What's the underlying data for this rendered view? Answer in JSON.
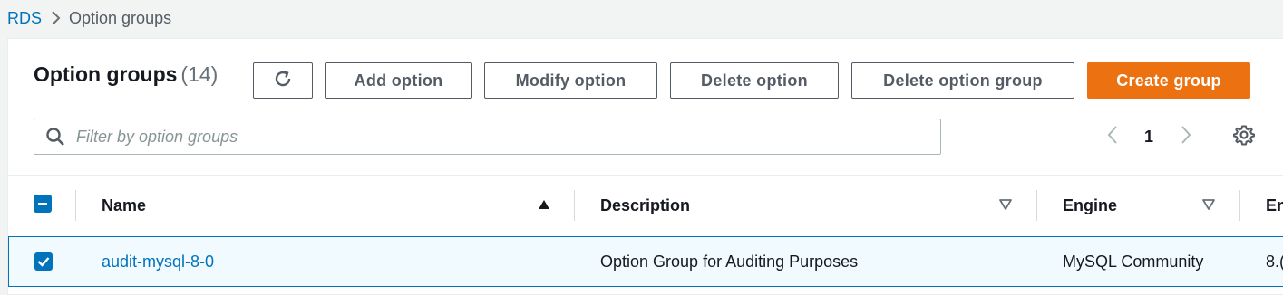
{
  "breadcrumb": {
    "root": "RDS",
    "current": "Option groups"
  },
  "header": {
    "title": "Option groups",
    "count": "(14)"
  },
  "toolbar": {
    "refresh_icon": "refresh-icon",
    "add_label": "Add option",
    "modify_label": "Modify option",
    "delete_label": "Delete option",
    "delete_group_label": "Delete option group",
    "create_label": "Create group"
  },
  "search": {
    "placeholder": "Filter by option groups",
    "value": ""
  },
  "pagination": {
    "current_page": "1"
  },
  "table": {
    "columns": [
      {
        "label": "Name",
        "sort": "ascending"
      },
      {
        "label": "Description",
        "sort": "none"
      },
      {
        "label": "Engine",
        "sort": "none"
      },
      {
        "label": "En",
        "sort": "none"
      }
    ],
    "rows": [
      {
        "selected": true,
        "name": "audit-mysql-8-0",
        "description": "Option Group for Auditing Purposes",
        "engine": "MySQL Community",
        "engine_version": "8.("
      }
    ]
  },
  "colors": {
    "link": "#0073bb",
    "primary": "#ec7211",
    "selected_row_bg": "#f1faff"
  }
}
